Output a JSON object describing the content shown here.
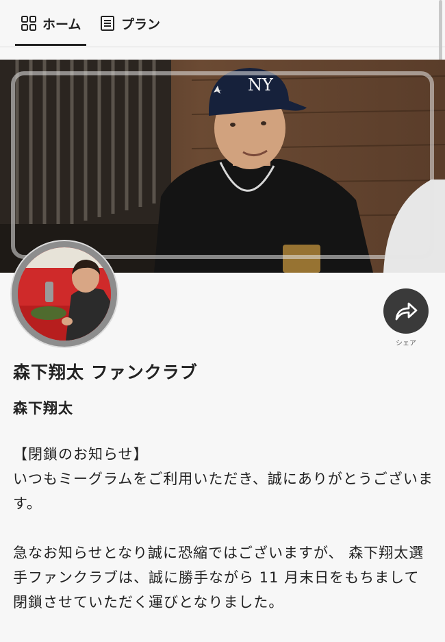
{
  "tabs": [
    {
      "label": "ホーム",
      "icon": "grid-icon",
      "active": true
    },
    {
      "label": "プラン",
      "icon": "document-icon",
      "active": false
    }
  ],
  "banner": {
    "cap_logo": "NY"
  },
  "share": {
    "label": "シェア"
  },
  "profile": {
    "club_title": "森下翔太 ファンクラブ",
    "owner_name": "森下翔太"
  },
  "notice": {
    "heading": "【閉鎖のお知らせ】",
    "line1": "いつもミーグラムをご利用いただき、誠にありがとうございます。",
    "line2": "急なお知らせとなり誠に恐縮ではございますが、 森下翔太選手ファンクラブは、誠に勝手ながら 11 月末日をもちまして閉鎖させていただく運びとなりました。"
  },
  "colors": {
    "background": "#f7f7f7",
    "text": "#222222",
    "share_button": "#3a3a3a"
  }
}
